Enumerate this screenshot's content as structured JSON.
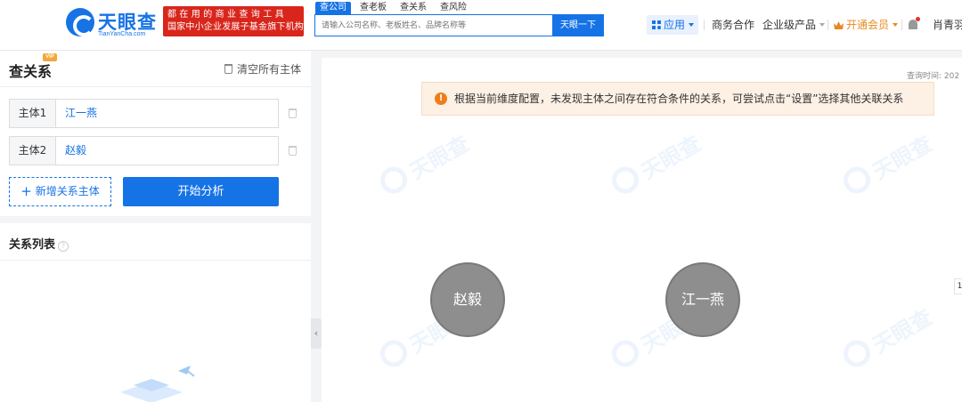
{
  "brand": {
    "logo_name": "天眼查",
    "logo_domain": "TianYanCha.com",
    "logo_icon": "tianyancha-logo-icon",
    "slogan_line1": "都在用的商业查询工具",
    "slogan_line2": "国家中小企业发展子基金旗下机构",
    "accent_color": "#1673e6",
    "slogan_color": "#d9261c"
  },
  "search": {
    "tabs": [
      "查公司",
      "查老板",
      "查关系",
      "查风险"
    ],
    "active_tab": "查公司",
    "placeholder": "请输入公司名称、老板姓名、品牌名称等",
    "button_label": "天眼一下"
  },
  "nav": {
    "app_label": "应用",
    "business_label": "商务合作",
    "enterprise_label": "企业级产品",
    "member_label": "开通会员",
    "member_color": "#e8891f",
    "user_label": "肖青羽"
  },
  "left_panel": {
    "title": "查关系",
    "vip_badge": "VIP",
    "clear_label": "清空所有主体",
    "subjects": [
      {
        "label": "主体1",
        "value": "江一燕"
      },
      {
        "label": "主体2",
        "value": "赵毅"
      }
    ],
    "add_label": "新增关系主体",
    "start_label": "开始分析",
    "list_title": "关系列表",
    "help_glyph": "?"
  },
  "canvas": {
    "query_time_label": "查询时间: 202",
    "alert_text": "根据当前维度配置，未发现主体之间存在符合条件的关系，可尝试点击“设置”选择其他关联关系",
    "alert_color": "#f07d1a",
    "alert_glyph": "!",
    "watermark_text": "天眼查",
    "nodes": [
      {
        "label": "赵毅"
      },
      {
        "label": "江一燕"
      }
    ],
    "node_color": "#8e8e8e",
    "side_number": "1"
  }
}
